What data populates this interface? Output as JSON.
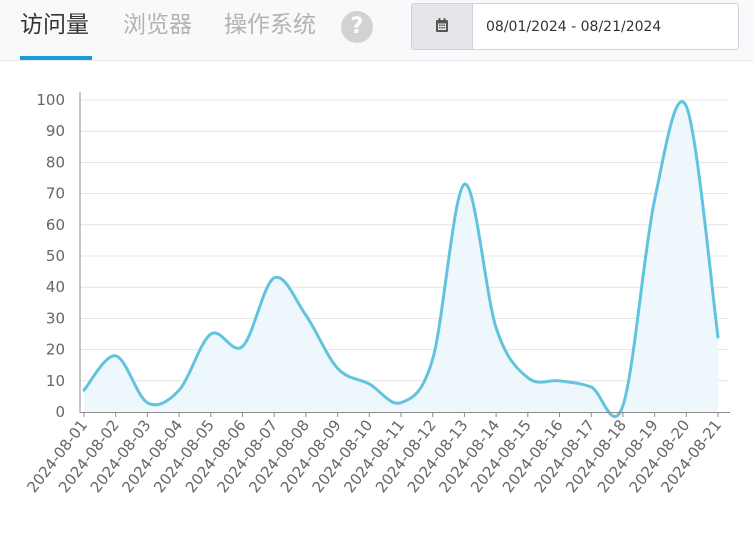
{
  "tabs": [
    {
      "label": "访问量",
      "active": true
    },
    {
      "label": "浏览器",
      "active": false
    },
    {
      "label": "操作系统",
      "active": false
    }
  ],
  "help": {
    "glyph": "?"
  },
  "date_range": {
    "icon": "calendar-icon",
    "value": "08/01/2024 - 08/21/2024"
  },
  "colors": {
    "accent": "#1e9ad6",
    "line": "#62c3de",
    "fill": "#eef7fb"
  },
  "chart_data": {
    "type": "area",
    "title": "",
    "xlabel": "",
    "ylabel": "",
    "x": [
      "2024-08-01",
      "2024-08-02",
      "2024-08-03",
      "2024-08-04",
      "2024-08-05",
      "2024-08-06",
      "2024-08-07",
      "2024-08-08",
      "2024-08-09",
      "2024-08-10",
      "2024-08-11",
      "2024-08-12",
      "2024-08-13",
      "2024-08-14",
      "2024-08-15",
      "2024-08-16",
      "2024-08-17",
      "2024-08-18",
      "2024-08-19",
      "2024-08-20",
      "2024-08-21"
    ],
    "series": [
      {
        "values": [
          7,
          18,
          3,
          7,
          25,
          21,
          43,
          31,
          14,
          9,
          3,
          17,
          73,
          27,
          11,
          10,
          8,
          2,
          68,
          98,
          24
        ]
      }
    ],
    "ylim": [
      0,
      100
    ],
    "yticks": [
      0,
      10,
      20,
      30,
      40,
      50,
      60,
      70,
      80,
      90,
      100
    ],
    "grid": true,
    "smooth": true
  }
}
